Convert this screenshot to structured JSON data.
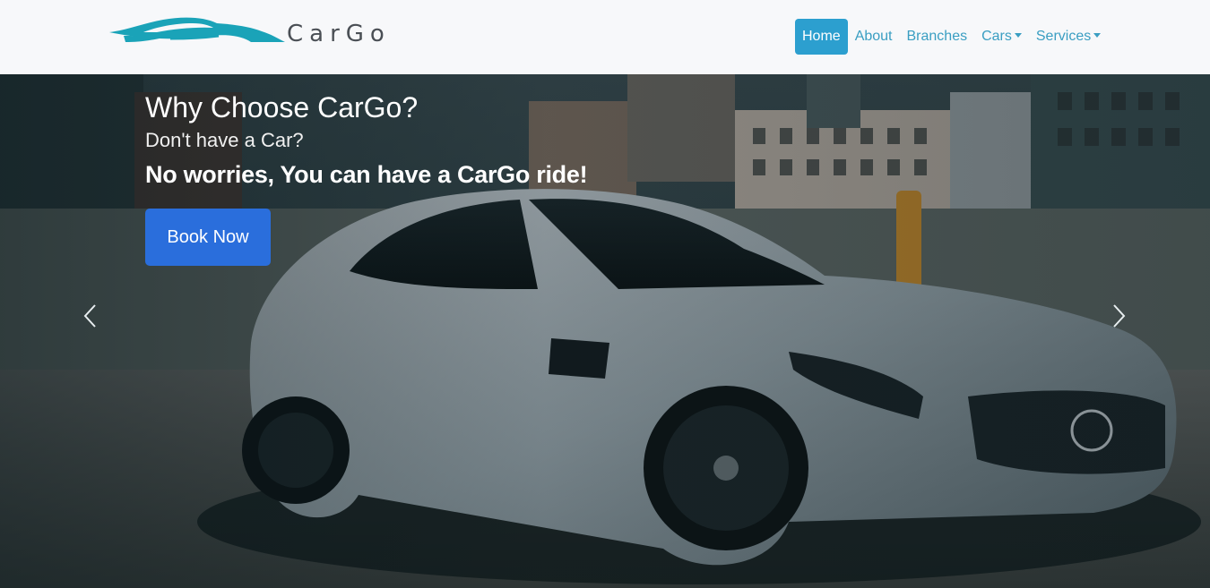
{
  "brand": {
    "name": "CarGo",
    "logo_icon": "car-silhouette-logo",
    "accent": "#1aa3b8"
  },
  "nav": {
    "items": [
      {
        "label": "Home",
        "active": true
      },
      {
        "label": "About"
      },
      {
        "label": "Branches"
      },
      {
        "label": "Cars",
        "dropdown": true
      },
      {
        "label": "Services",
        "dropdown": true
      }
    ]
  },
  "hero": {
    "title": "Why Choose CarGo?",
    "subtitle": "Don't have a Car?",
    "tagline": "No worries, You can have a CarGo ride!",
    "cta_label": "Book Now",
    "cta_color": "#2a6edc",
    "prev_icon": "chevron-left-icon",
    "next_icon": "chevron-right-icon",
    "background": "silver sports car parked on rooftop with city buildings"
  }
}
